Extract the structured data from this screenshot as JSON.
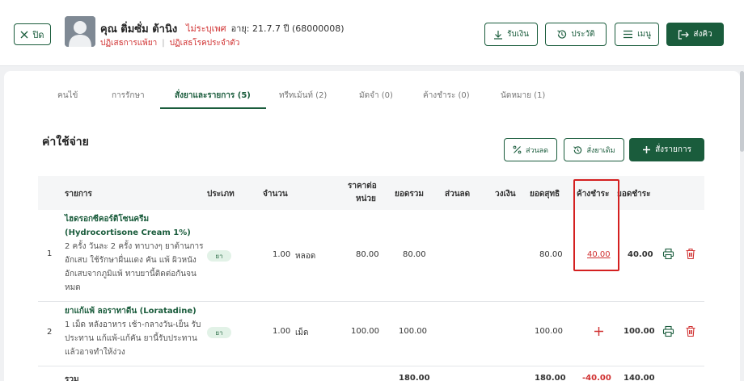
{
  "header": {
    "close_label": "ปิด",
    "patient_name": "คุณ ติ่มซั่ม ต้านิง",
    "gender": "ไม่ระบุเพศ",
    "age_hn": "อายุ: 21.7.7 ปี  (68000008)",
    "allergy": "ปฏิเสธการแพ้ยา",
    "chronic": "ปฏิเสธโรคประจำตัว",
    "btn_receive": "รับเงิน",
    "btn_history": "ประวัติ",
    "btn_menu": "เมนู",
    "btn_send": "ส่งคิว"
  },
  "tabs": [
    "คนไข้",
    "การรักษา",
    "สั่งยาและรายการ (5)",
    "ทรีทเม้นท์ (2)",
    "มัดจำ (0)",
    "ค้างชำระ (0)",
    "นัดหมาย (1)"
  ],
  "section": {
    "title": "ค่าใช้จ่าย",
    "btn_discount": "ส่วนลด",
    "btn_previous": "สั่งยาเดิม",
    "btn_order": "สั่งรายการ"
  },
  "table": {
    "headers": {
      "item": "รายการ",
      "type": "ประเภท",
      "qty": "จำนวน",
      "price_line1": "ราคาต่อ",
      "price_line2": "หน่วย",
      "total": "ยอดรวม",
      "discount": "ส่วนลด",
      "limit": "วงเงิน",
      "net": "ยอดสุทธิ",
      "outstanding": "ค้างชำระ",
      "paid": "ยอดชำระ"
    },
    "rows": [
      {
        "no": "1",
        "name1": "ไฮดรอกซีคอร์ติโซนครีม",
        "name2": "(Hydrocortisone Cream 1%)",
        "desc": [
          "2 ครั้ง วันละ 2 ครั้ง ทาบางๆ ยาต้านการ",
          "อักเสบ ใช้รักษาผื่นแดง คัน แพ้ ผิวหนัง",
          "อักเสบจากภูมิแพ้ ทาบยานี้ติดต่อกันจน",
          "หมด"
        ],
        "type": "ยา",
        "qty": "1.00",
        "unit": "หลอด",
        "price": "80.00",
        "total": "80.00",
        "net": "80.00",
        "outstanding": "40.00",
        "paid": "40.00"
      },
      {
        "no": "2",
        "name1": "ยาแก้แพ้ ลอราทาดีน (Loratadine)",
        "desc": [
          "1 เม็ด หลังอาหาร เช้า-กลางวัน-เย็น รับ",
          "ประทาน แก้แพ้-แก้คัน ยานี้รับประทาน",
          "แล้วอาจทำให้ง่วง"
        ],
        "type": "ยา",
        "qty": "1.00",
        "unit": "เม็ด",
        "price": "100.00",
        "total": "100.00",
        "net": "100.00",
        "paid": "100.00"
      }
    ],
    "summary": {
      "label": "รวม",
      "total": "180.00",
      "net": "180.00",
      "outstanding": "-40.00",
      "paid": "140.00"
    }
  },
  "colors": {
    "primary": "#1a5c3c",
    "danger": "#d03030",
    "highlight": "#d42020"
  }
}
